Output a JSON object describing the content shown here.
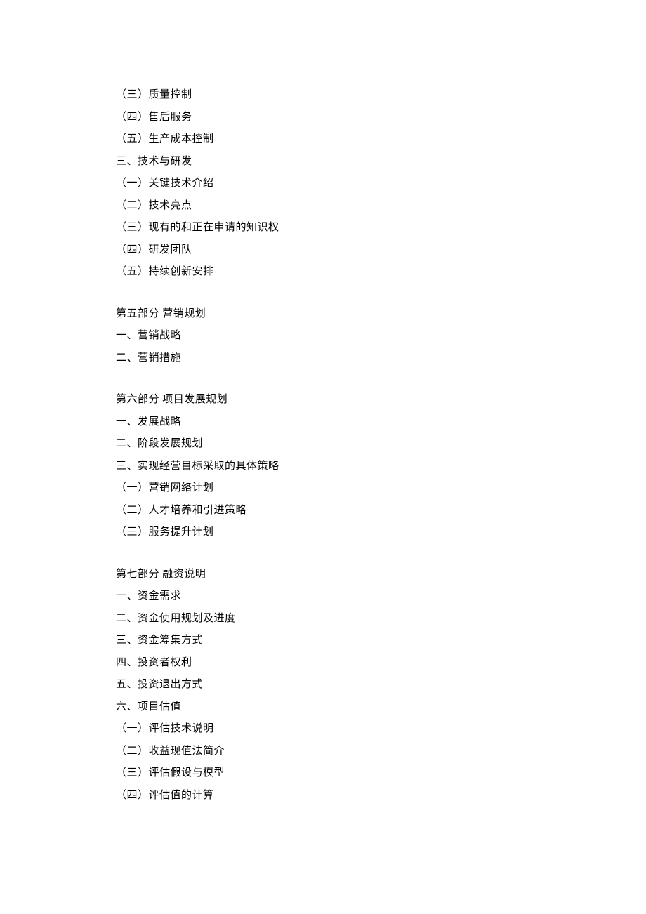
{
  "lines": [
    {
      "text": "（三）质量控制",
      "gap": false
    },
    {
      "text": "（四）售后服务",
      "gap": false
    },
    {
      "text": "（五）生产成本控制",
      "gap": false
    },
    {
      "text": "三、技术与研发",
      "gap": false
    },
    {
      "text": "（一）关键技术介绍",
      "gap": false
    },
    {
      "text": "（二）技术亮点",
      "gap": false
    },
    {
      "text": "（三）现有的和正在申请的知识权",
      "gap": false
    },
    {
      "text": "（四）研发团队",
      "gap": false
    },
    {
      "text": "（五）持续创新安排",
      "gap": false
    },
    {
      "text": "第五部分  营销规划",
      "gap": true
    },
    {
      "text": "一、营销战略",
      "gap": false
    },
    {
      "text": "二、营销措施",
      "gap": false
    },
    {
      "text": "第六部分  项目发展规划",
      "gap": true
    },
    {
      "text": "一、发展战略",
      "gap": false
    },
    {
      "text": "二、阶段发展规划",
      "gap": false
    },
    {
      "text": "三、实现经营目标采取的具体策略",
      "gap": false
    },
    {
      "text": "（一）营销网络计划",
      "gap": false
    },
    {
      "text": "（二）人才培养和引进策略",
      "gap": false
    },
    {
      "text": "（三）服务提升计划",
      "gap": false
    },
    {
      "text": "第七部分  融资说明",
      "gap": true
    },
    {
      "text": "一、资金需求",
      "gap": false
    },
    {
      "text": "二、资金使用规划及进度",
      "gap": false
    },
    {
      "text": "三、资金筹集方式",
      "gap": false
    },
    {
      "text": "四、投资者权利",
      "gap": false
    },
    {
      "text": "五、投资退出方式",
      "gap": false
    },
    {
      "text": "六、项目估值",
      "gap": false
    },
    {
      "text": "（一）评估技术说明",
      "gap": false
    },
    {
      "text": "（二）收益现值法简介",
      "gap": false
    },
    {
      "text": "（三）评估假设与模型",
      "gap": false
    },
    {
      "text": "（四）评估值的计算",
      "gap": false
    }
  ]
}
